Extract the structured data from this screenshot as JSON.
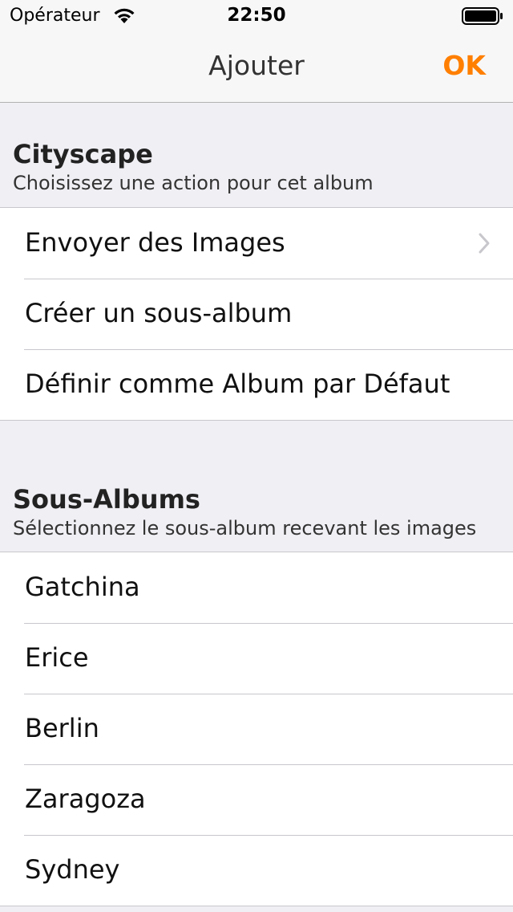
{
  "status_bar": {
    "carrier": "Opérateur",
    "time": "22:50",
    "wifi_icon": "wifi-icon",
    "battery_icon": "battery-icon"
  },
  "nav": {
    "title": "Ajouter",
    "done_label": "OK",
    "accent_color": "#ff7f00"
  },
  "album_section": {
    "title": "Cityscape",
    "subtitle": "Choisissez une action pour cet album",
    "actions": [
      {
        "label": "Envoyer des Images",
        "icon": "chevron-right-icon"
      },
      {
        "label": "Créer un sous-album"
      },
      {
        "label": "Définir comme Album par Défaut"
      }
    ]
  },
  "subalbums_section": {
    "title": "Sous-Albums",
    "subtitle": "Sélectionnez le sous-album recevant les images",
    "items": [
      "Gatchina",
      "Erice",
      "Berlin",
      "Zaragoza",
      "Sydney"
    ]
  }
}
